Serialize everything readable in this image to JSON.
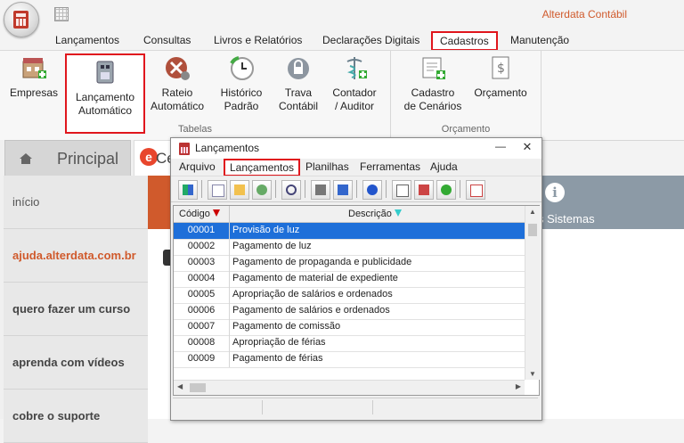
{
  "app": {
    "title": "Alterdata Contábil"
  },
  "menu": {
    "items": [
      "Lançamentos",
      "Consultas",
      "Livros e Relatórios",
      "Declarações Digitais",
      "Cadastros",
      "Manutenção"
    ],
    "active": "Cadastros"
  },
  "ribbon": {
    "group_tabelas": "Tabelas",
    "group_orcamento": "Orçamento",
    "buttons": [
      {
        "l1": "Empresas",
        "l2": ""
      },
      {
        "l1": "Lançamento",
        "l2": "Automático"
      },
      {
        "l1": "Rateio",
        "l2": "Automático"
      },
      {
        "l1": "Histórico",
        "l2": "Padrão"
      },
      {
        "l1": "Trava",
        "l2": "Contábil"
      },
      {
        "l1": "Contador",
        "l2": "/ Auditor"
      },
      {
        "l1": "Cadastro",
        "l2": "de Cenários"
      },
      {
        "l1": "Orçamento",
        "l2": ""
      }
    ]
  },
  "tabs": {
    "principal": "Principal",
    "ce": "Ce"
  },
  "nav": [
    "início",
    "ajuda.alterdata.com.br",
    "quero fazer um curso",
    "aprenda com vídeos",
    "cobre o suporte"
  ],
  "banner": {
    "text": "s Sistemas",
    "info_glyph": "i"
  },
  "dialog": {
    "title": "Lançamentos",
    "min_glyph": "—",
    "close_glyph": "✕",
    "menu": [
      "Arquivo",
      "Lançamentos",
      "Planilhas",
      "Ferramentas",
      "Ajuda"
    ],
    "active_menu": "Lançamentos",
    "columns": {
      "code": "Código",
      "desc": "Descrição"
    },
    "rows": [
      {
        "code": "00001",
        "desc": "Provisão de luz"
      },
      {
        "code": "00002",
        "desc": "Pagamento de luz"
      },
      {
        "code": "00003",
        "desc": "Pagamento de propaganda e publicidade"
      },
      {
        "code": "00004",
        "desc": "Pagamento de material de expediente"
      },
      {
        "code": "00005",
        "desc": "Apropriação de salários e ordenados"
      },
      {
        "code": "00006",
        "desc": "Pagamento de salários e ordenados"
      },
      {
        "code": "00007",
        "desc": "Pagamento de comissão"
      },
      {
        "code": "00008",
        "desc": "Apropriação de férias"
      },
      {
        "code": "00009",
        "desc": "Pagamento de férias"
      }
    ],
    "selected_row": 0
  },
  "colors": {
    "accent": "#d05a2c",
    "highlight": "#e0161d",
    "selection": "#1e6fd9"
  }
}
